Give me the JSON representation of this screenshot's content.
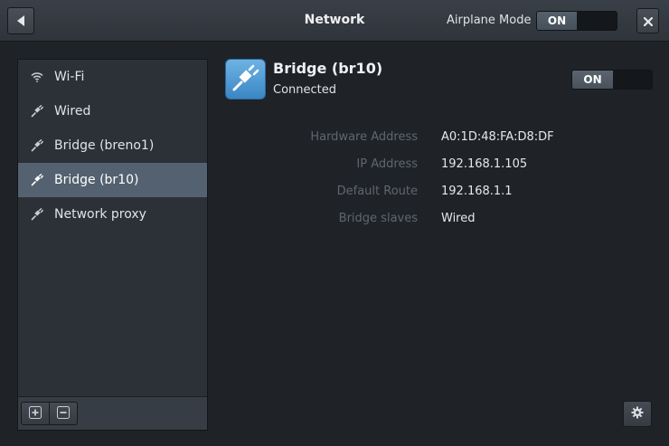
{
  "header": {
    "title": "Network",
    "back_icon": "back-arrow-icon",
    "airplane_mode": {
      "label": "Airplane Mode",
      "state": "ON",
      "on": true
    },
    "close_icon": "close-icon"
  },
  "sidebar": {
    "items": [
      {
        "label": "Wi-Fi",
        "icon": "wifi-icon",
        "selected": false
      },
      {
        "label": "Wired",
        "icon": "network-plug-icon",
        "selected": false
      },
      {
        "label": "Bridge (breno1)",
        "icon": "network-plug-icon",
        "selected": false
      },
      {
        "label": "Bridge (br10)",
        "icon": "network-plug-icon",
        "selected": true
      },
      {
        "label": "Network proxy",
        "icon": "network-plug-icon",
        "selected": false
      }
    ],
    "toolbar": {
      "add_icon": "add-icon",
      "remove_icon": "remove-icon"
    }
  },
  "device": {
    "name": "Bridge (br10)",
    "status": "Connected",
    "icon": "network-plug-icon",
    "switch": {
      "state": "ON",
      "on": true
    },
    "details": [
      {
        "label": "Hardware Address",
        "value": "A0:1D:48:FA:D8:DF"
      },
      {
        "label": "IP Address",
        "value": "192.168.1.105"
      },
      {
        "label": "Default Route",
        "value": "192.168.1.1"
      },
      {
        "label": "Bridge slaves",
        "value": "Wired"
      }
    ]
  },
  "settings_icon": "gear-icon",
  "colors": {
    "background": "#1f2327",
    "sidebar": "#2c3137",
    "selected": "#536170",
    "device_icon": "#4a97d4"
  }
}
